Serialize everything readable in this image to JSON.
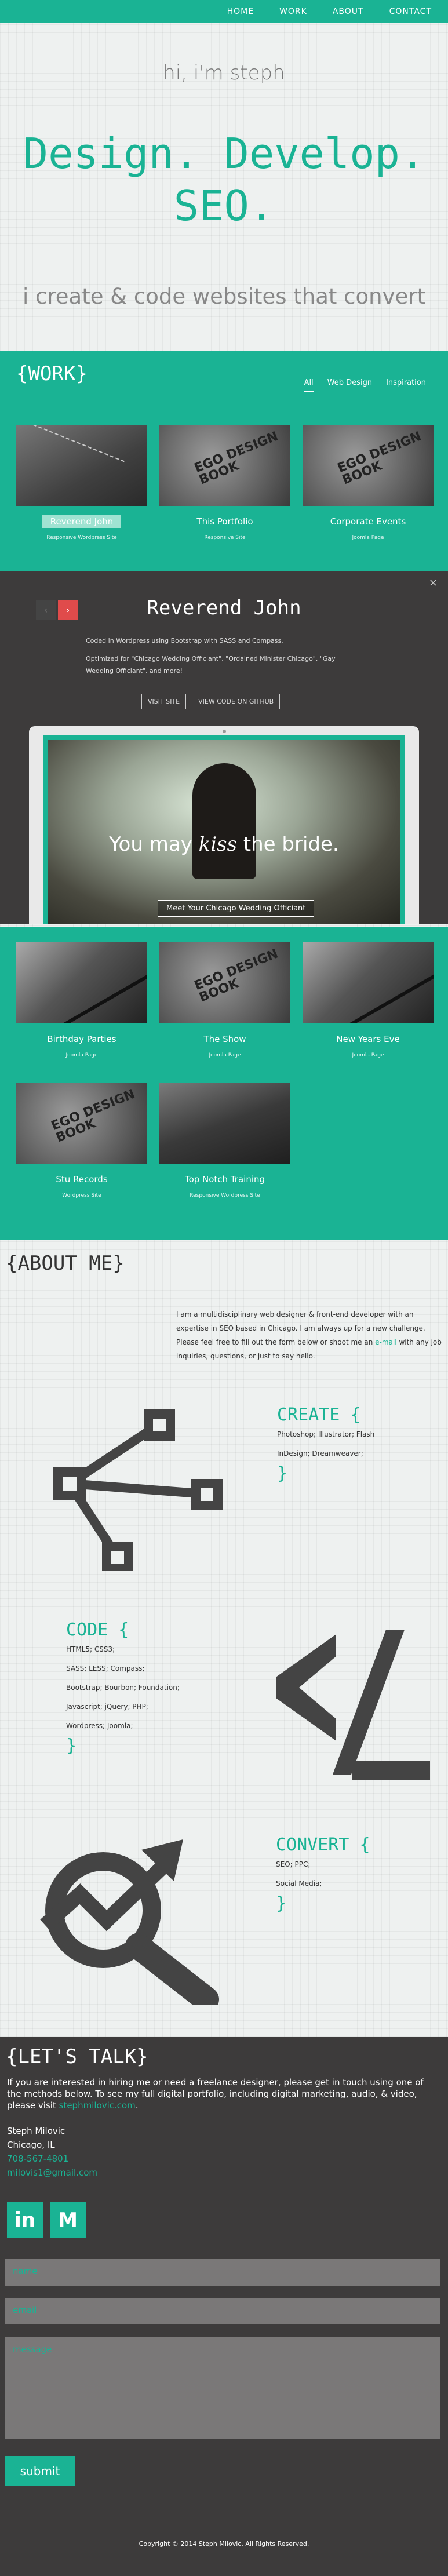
{
  "nav": {
    "home": "HOME",
    "work": "WORK",
    "about": "ABOUT",
    "contact": "CONTACT"
  },
  "hero": {
    "greeting": "hi, i'm steph",
    "headline_1": "Design. Develop.",
    "headline_2": "SEO.",
    "tagline": "i create & code websites that convert"
  },
  "work": {
    "title": "{WORK}",
    "filters": [
      "All",
      "Web Design",
      "Inspiration"
    ],
    "items": [
      {
        "name": "Reverend John",
        "kind": "Responsive Wordpress Site"
      },
      {
        "name": "This Portfolio",
        "kind": "Responsive Site"
      },
      {
        "name": "Corporate Events",
        "kind": "Joomla Page"
      }
    ],
    "items2": [
      {
        "name": "Birthday Parties",
        "kind": "Joomla Page"
      },
      {
        "name": "The Show",
        "kind": "Joomla Page"
      },
      {
        "name": "New Years Eve",
        "kind": "Joomla Page"
      },
      {
        "name": "Stu Records",
        "kind": "Wordpress Site"
      },
      {
        "name": "Top Notch Training",
        "kind": "Responsive Wordpress Site"
      }
    ],
    "book_text": "EGO DESIGN BOOK"
  },
  "detail": {
    "close": "×",
    "prev": "‹",
    "next": "›",
    "title": "Reverend John",
    "line1": "Coded in Wordpress using Bootstrap with SASS and Compass.",
    "line2": "Optimized for \"Chicago Wedding Officiant\", \"Ordained Minister Chicago\", \"Gay Wedding Officiant\", and more!",
    "visit": "VISIT SITE",
    "github": "VIEW CODE ON GITHUB",
    "tagline_a": "You may",
    "tagline_b": "kiss",
    "tagline_c": "the bride.",
    "meet": "Meet Your Chicago Wedding Officiant"
  },
  "about": {
    "title": "{ABOUT ME}",
    "intro_a": "I am a multidisciplinary web designer & front-end developer with an expertise in SEO based in Chicago. I am always up for a new challenge. Please feel free to fill out the form below or shoot me an",
    "intro_link": "e-mail",
    "intro_b": "with any job inquiries, questions, or just to say hello.",
    "create": {
      "title": "CREATE {",
      "lines": [
        "Photoshop; Illustrator; Flash",
        "InDesign; Dreamweaver;"
      ],
      "close": "}"
    },
    "code": {
      "title": "CODE {",
      "lines": [
        "HTML5; CSS3;",
        "SASS; LESS; Compass;",
        "Bootstrap; Bourbon; Foundation;",
        "Javascript; jQuery; PHP;",
        "Wordpress; Joomla;"
      ],
      "close": "}"
    },
    "convert": {
      "title": "CONVERT {",
      "lines": [
        "SEO; PPC;",
        "Social Media;"
      ],
      "close": "}"
    }
  },
  "contact": {
    "title": "{LET'S TALK}",
    "text": "If you are interested in hiring me or need a freelance designer, please get in touch using one of the methods below. To see my full digital portfolio, including digital marketing, audio, & video, please visit",
    "link": "stephmilovic.com",
    "name": "Steph Milovic",
    "city": "Chicago, IL",
    "phone": "708-567-4801",
    "email": "milovis1@gmail.com",
    "linkedin": "in",
    "mail": "M",
    "ph_name": "name",
    "ph_email": "email",
    "ph_message": "message",
    "submit": "submit",
    "copyright": "Copyright © 2014 Steph Milovic. All Rights Reserved."
  },
  "colors": {
    "accent": "#1ab394",
    "dark": "#3d3b3b",
    "alert": "#e04b4b"
  }
}
